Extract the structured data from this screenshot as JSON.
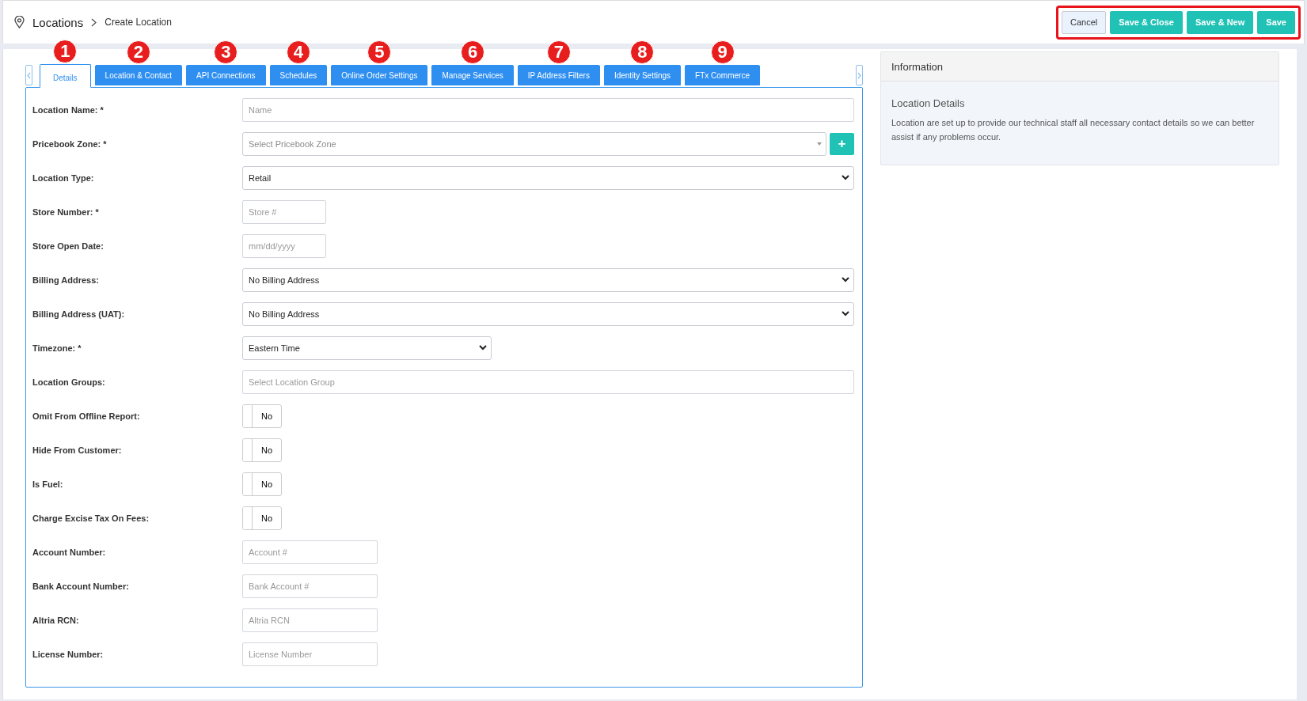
{
  "breadcrumb": {
    "title": "Locations",
    "current": "Create Location"
  },
  "actions": [
    {
      "label": "Cancel",
      "kind": "secondary"
    },
    {
      "label": "Save & Close",
      "kind": "primary"
    },
    {
      "label": "Save & New",
      "kind": "primary"
    },
    {
      "label": "Save",
      "kind": "primary"
    }
  ],
  "tabs": [
    {
      "label": "Details",
      "selected": true,
      "callout": "1"
    },
    {
      "label": "Location & Contact",
      "selected": false,
      "callout": "2"
    },
    {
      "label": "API Connections",
      "selected": false,
      "callout": "3"
    },
    {
      "label": "Schedules",
      "selected": false,
      "callout": "4"
    },
    {
      "label": "Online Order Settings",
      "selected": false,
      "callout": "5"
    },
    {
      "label": "Manage Services",
      "selected": false,
      "callout": "6"
    },
    {
      "label": "IP Address Filters",
      "selected": false,
      "callout": "7"
    },
    {
      "label": "Identity Settings",
      "selected": false,
      "callout": "8"
    },
    {
      "label": "FTx Commerce",
      "selected": false,
      "callout": "9"
    }
  ],
  "fields": [
    {
      "label": "Location Name: *",
      "kind": "text",
      "placeholder": "Name"
    },
    {
      "label": "Pricebook Zone: *",
      "kind": "picker",
      "placeholder": "Select Pricebook Zone",
      "add_button": "+"
    },
    {
      "label": "Location Type:",
      "kind": "select",
      "value": "Retail"
    },
    {
      "label": "Store Number: *",
      "kind": "short-text",
      "placeholder": "Store #"
    },
    {
      "label": "Store Open Date:",
      "kind": "short-text",
      "placeholder": "mm/dd/yyyy"
    },
    {
      "label": "Billing Address:",
      "kind": "select",
      "value": "No Billing Address"
    },
    {
      "label": "Billing Address (UAT):",
      "kind": "select",
      "value": "No Billing Address"
    },
    {
      "label": "Timezone: *",
      "kind": "narrow-select",
      "value": "Eastern Time"
    },
    {
      "label": "Location Groups:",
      "kind": "text",
      "placeholder": "Select Location Group"
    },
    {
      "label": "Omit From Offline Report:",
      "kind": "toggle",
      "on": false,
      "value": "No"
    },
    {
      "label": "Hide From Customer:",
      "kind": "toggle",
      "on": false,
      "value": "No"
    },
    {
      "label": "Is Fuel:",
      "kind": "toggle",
      "on": false,
      "value": "No"
    },
    {
      "label": "Charge Excise Tax On Fees:",
      "kind": "toggle",
      "on": false,
      "value": "No"
    },
    {
      "label": "Account Number:",
      "kind": "medium-text",
      "placeholder": "Account #"
    },
    {
      "label": "Bank Account Number:",
      "kind": "medium-text",
      "placeholder": "Bank Account #"
    },
    {
      "label": "Altria RCN:",
      "kind": "medium-text",
      "placeholder": "Altria RCN"
    },
    {
      "label": "License Number:",
      "kind": "medium-text",
      "placeholder": "License Number"
    }
  ],
  "information": {
    "title": "Information",
    "heading": "Location Details",
    "text": "Location are set up to provide our technical staff all necessary contact details so we can better assist if any problems occur."
  }
}
